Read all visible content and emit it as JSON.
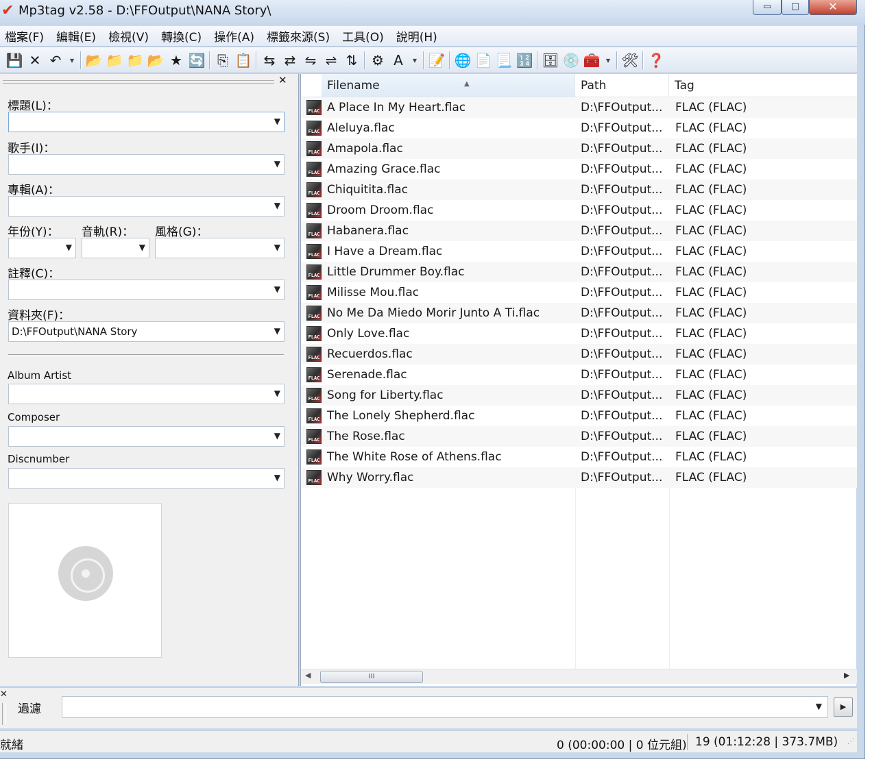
{
  "window": {
    "title": "Mp3tag v2.58  -  D:\\FFOutput\\NANA Story\\",
    "minimize": "▭",
    "maximize": "□",
    "close": "✕"
  },
  "menu": [
    "檔案(F)",
    "編輯(E)",
    "檢視(V)",
    "轉換(C)",
    "操作(A)",
    "標籤來源(S)",
    "工具(O)",
    "說明(H)"
  ],
  "toolbar": {
    "icons": [
      {
        "name": "save-icon",
        "glyph": "💾"
      },
      {
        "name": "remove-tag-icon",
        "glyph": "✕"
      },
      {
        "name": "undo-icon",
        "glyph": "↶"
      },
      {
        "name": "undo-dropdown-icon",
        "glyph": "▾",
        "small": true
      },
      {
        "sep": true
      },
      {
        "name": "change-directory-icon",
        "glyph": "📂"
      },
      {
        "name": "add-directory-icon",
        "glyph": "📁"
      },
      {
        "name": "open-folder-icon",
        "glyph": "📁"
      },
      {
        "name": "open-playlist-icon",
        "glyph": "📂"
      },
      {
        "name": "favorites-icon",
        "glyph": "★"
      },
      {
        "name": "refresh-icon",
        "glyph": "🔄"
      },
      {
        "sep": true
      },
      {
        "name": "copy-tag-icon",
        "glyph": "⎘"
      },
      {
        "name": "paste-tag-icon",
        "glyph": "📋"
      },
      {
        "sep": true
      },
      {
        "name": "tag-filename-icon",
        "glyph": "⇆"
      },
      {
        "name": "filename-tag-icon",
        "glyph": "⇄"
      },
      {
        "name": "filename-filename-icon",
        "glyph": "⇋"
      },
      {
        "name": "text-tag-icon",
        "glyph": "⇌"
      },
      {
        "name": "tag-tag-icon",
        "glyph": "⇅"
      },
      {
        "sep": true
      },
      {
        "name": "actions-icon",
        "glyph": "⚙"
      },
      {
        "name": "quick-actions-icon",
        "glyph": "A"
      },
      {
        "name": "actions-dropdown-icon",
        "glyph": "▾",
        "small": true
      },
      {
        "sep": true
      },
      {
        "name": "extended-tags-icon",
        "glyph": "📝"
      },
      {
        "sep": true
      },
      {
        "name": "web-source-icon",
        "glyph": "🌐"
      },
      {
        "name": "export-icon",
        "glyph": "📄"
      },
      {
        "name": "playlist-icon",
        "glyph": "📃"
      },
      {
        "name": "autonumbering-icon",
        "glyph": "🔢"
      },
      {
        "sep": true
      },
      {
        "name": "freedb-icon",
        "glyph": "🗄"
      },
      {
        "name": "cd-icon",
        "glyph": "💿"
      },
      {
        "name": "tag-sources-icon",
        "glyph": "🧰"
      },
      {
        "name": "sources-dropdown-icon",
        "glyph": "▾",
        "small": true
      },
      {
        "sep": true
      },
      {
        "name": "options-icon",
        "glyph": "🛠"
      },
      {
        "sep": true
      },
      {
        "name": "help-icon",
        "glyph": "❓"
      }
    ]
  },
  "tag_panel": {
    "close": "✕",
    "fields": {
      "title": {
        "label": "標題(L)：",
        "value": ""
      },
      "artist": {
        "label": "歌手(I)：",
        "value": ""
      },
      "album": {
        "label": "專輯(A)：",
        "value": ""
      },
      "year": {
        "label": "年份(Y)：",
        "value": ""
      },
      "track": {
        "label": "音軌(R)：",
        "value": ""
      },
      "genre": {
        "label": "風格(G)：",
        "value": ""
      },
      "comment": {
        "label": "註釋(C)：",
        "value": ""
      },
      "directory": {
        "label": "資料夾(F)：",
        "value": "D:\\FFOutput\\NANA Story"
      },
      "album_artist": {
        "label": "Album Artist",
        "value": ""
      },
      "composer": {
        "label": "Composer",
        "value": ""
      },
      "discnumber": {
        "label": "Discnumber",
        "value": ""
      }
    }
  },
  "file_list": {
    "columns": {
      "filename": "Filename",
      "path": "Path",
      "tag": "Tag"
    },
    "sort_indicator": "▲",
    "rows": [
      {
        "filename": "A Place In My Heart.flac",
        "path": "D:\\FFOutput...",
        "tag": "FLAC (FLAC)"
      },
      {
        "filename": "Aleluya.flac",
        "path": "D:\\FFOutput...",
        "tag": "FLAC (FLAC)"
      },
      {
        "filename": "Amapola.flac",
        "path": "D:\\FFOutput...",
        "tag": "FLAC (FLAC)"
      },
      {
        "filename": "Amazing Grace.flac",
        "path": "D:\\FFOutput...",
        "tag": "FLAC (FLAC)"
      },
      {
        "filename": "Chiquitita.flac",
        "path": "D:\\FFOutput...",
        "tag": "FLAC (FLAC)"
      },
      {
        "filename": "Droom Droom.flac",
        "path": "D:\\FFOutput...",
        "tag": "FLAC (FLAC)"
      },
      {
        "filename": "Habanera.flac",
        "path": "D:\\FFOutput...",
        "tag": "FLAC (FLAC)"
      },
      {
        "filename": "I Have a Dream.flac",
        "path": "D:\\FFOutput...",
        "tag": "FLAC (FLAC)"
      },
      {
        "filename": "Little Drummer Boy.flac",
        "path": "D:\\FFOutput...",
        "tag": "FLAC (FLAC)"
      },
      {
        "filename": "Milisse Mou.flac",
        "path": "D:\\FFOutput...",
        "tag": "FLAC (FLAC)"
      },
      {
        "filename": "No Me Da Miedo Morir Junto A Ti.flac",
        "path": "D:\\FFOutput...",
        "tag": "FLAC (FLAC)"
      },
      {
        "filename": "Only Love.flac",
        "path": "D:\\FFOutput...",
        "tag": "FLAC (FLAC)"
      },
      {
        "filename": "Recuerdos.flac",
        "path": "D:\\FFOutput...",
        "tag": "FLAC (FLAC)"
      },
      {
        "filename": "Serenade.flac",
        "path": "D:\\FFOutput...",
        "tag": "FLAC (FLAC)"
      },
      {
        "filename": "Song for Liberty.flac",
        "path": "D:\\FFOutput...",
        "tag": "FLAC (FLAC)"
      },
      {
        "filename": "The Lonely Shepherd.flac",
        "path": "D:\\FFOutput...",
        "tag": "FLAC (FLAC)"
      },
      {
        "filename": "The Rose.flac",
        "path": "D:\\FFOutput...",
        "tag": "FLAC (FLAC)"
      },
      {
        "filename": "The White Rose of Athens.flac",
        "path": "D:\\FFOutput...",
        "tag": "FLAC (FLAC)"
      },
      {
        "filename": "Why Worry.flac",
        "path": "D:\\FFOutput...",
        "tag": "FLAC (FLAC)"
      }
    ],
    "file_icon_text": "FLAC",
    "scrollbar_thumb": "III"
  },
  "filter": {
    "close": "✕",
    "label": "過濾",
    "value": "",
    "go_glyph": "▶"
  },
  "status": {
    "ready": "就緒",
    "selection": "0 (00:00:00 | 0 位元組)",
    "total": "19 (01:12:28 | 373.7MB)"
  }
}
